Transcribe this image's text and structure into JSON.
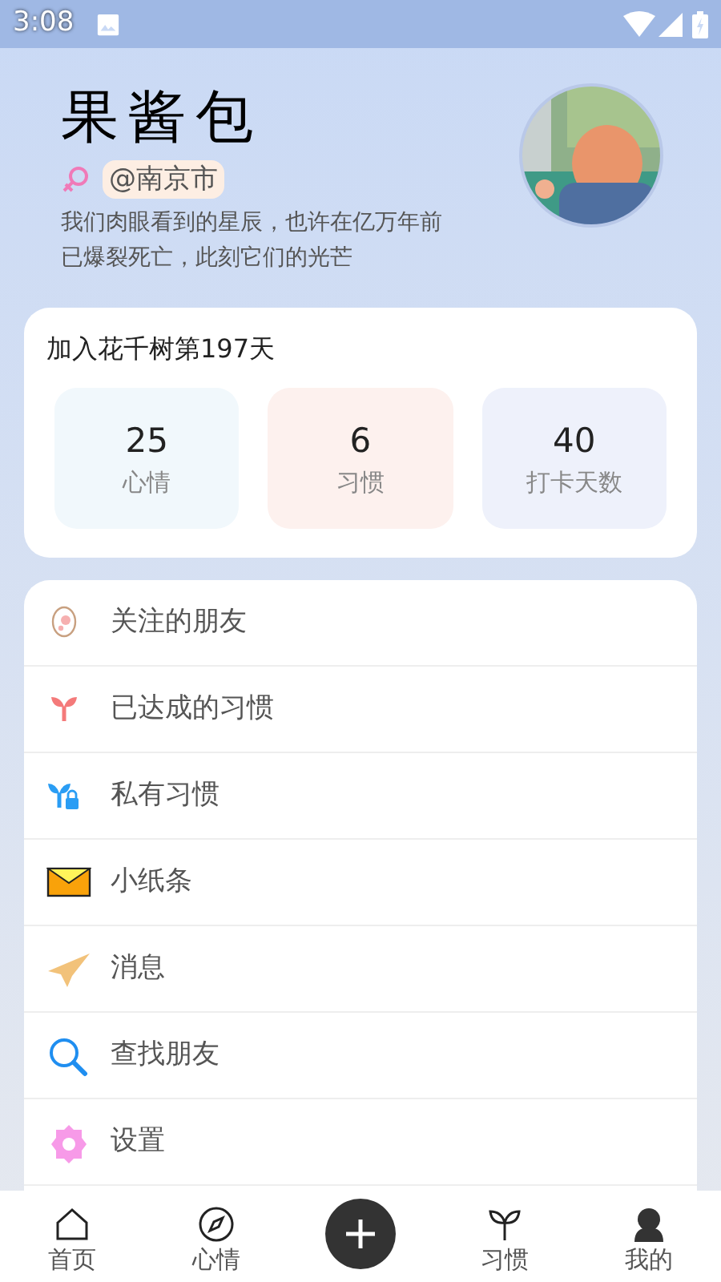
{
  "status_bar": {
    "time": "3:08"
  },
  "profile": {
    "name": "果酱包",
    "female": true,
    "location": "@南京市",
    "bio": "我们肉眼看到的星辰，也许在亿万年前已爆裂死亡，此刻它们的光芒"
  },
  "stats_card": {
    "title": "加入花千树第197天",
    "stats": [
      {
        "value": "25",
        "label": "心情",
        "color": "#f1f8fc"
      },
      {
        "value": "6",
        "label": "习惯",
        "color": "#fdf1ee"
      },
      {
        "value": "40",
        "label": "打卡天数",
        "color": "#eef1fb"
      }
    ]
  },
  "menu": [
    {
      "kind": "egg",
      "label": "关注的朋友"
    },
    {
      "kind": "sprout",
      "label": "已达成的习惯"
    },
    {
      "kind": "private",
      "label": "私有习惯"
    },
    {
      "kind": "envelope",
      "label": "小纸条"
    },
    {
      "kind": "plane",
      "label": "消息"
    },
    {
      "kind": "search",
      "label": "查找朋友"
    },
    {
      "kind": "gear",
      "label": "设置"
    }
  ],
  "bottom_nav": [
    {
      "kind": "home",
      "label": "首页"
    },
    {
      "kind": "compass",
      "label": "心情"
    },
    {
      "kind": "add"
    },
    {
      "kind": "sprout",
      "label": "习惯"
    },
    {
      "kind": "person",
      "label": "我的"
    }
  ]
}
